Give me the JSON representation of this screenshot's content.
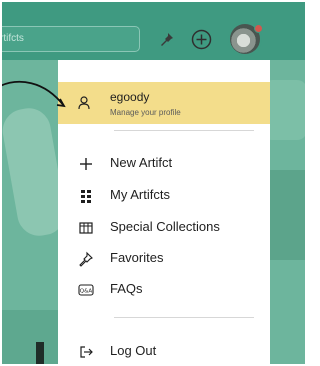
{
  "header": {
    "search_text": "rtifcts",
    "pin_icon": "pin-icon",
    "add_icon": "plus-circle-icon",
    "avatar_icon": "user-avatar"
  },
  "profile": {
    "username": "egoody",
    "subtext": "Manage your profile"
  },
  "menu": {
    "items": [
      {
        "label": "New Artifct",
        "icon": "plus-icon"
      },
      {
        "label": "My Artifcts",
        "icon": "grid-icon"
      },
      {
        "label": "Special Collections",
        "icon": "collection-icon"
      },
      {
        "label": "Favorites",
        "icon": "pin-icon"
      },
      {
        "label": "FAQs",
        "icon": "faq-icon"
      }
    ],
    "logout": {
      "label": "Log Out",
      "icon": "logout-icon"
    }
  },
  "colors": {
    "header": "#3f9a81",
    "profile_highlight": "#f3dd8b",
    "background": "#6db59d"
  }
}
